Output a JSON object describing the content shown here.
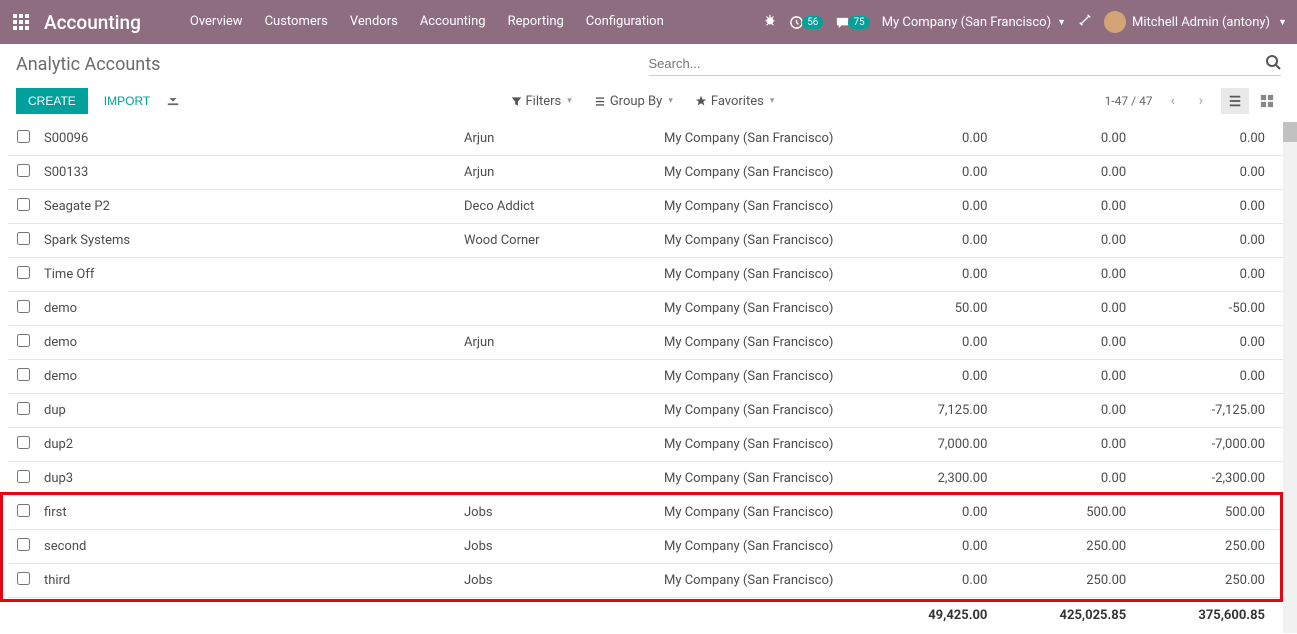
{
  "topnav": {
    "brand": "Accounting",
    "links": [
      "Overview",
      "Customers",
      "Vendors",
      "Accounting",
      "Reporting",
      "Configuration"
    ],
    "badge1": "56",
    "badge2": "75",
    "company": "My Company (San Francisco)",
    "user": "Mitchell Admin (antony)"
  },
  "cp": {
    "title": "Analytic Accounts",
    "search_placeholder": "Search...",
    "create": "CREATE",
    "import": "IMPORT",
    "filters": "Filters",
    "groupby": "Group By",
    "favorites": "Favorites",
    "pager": "1-47 / 47"
  },
  "rows": [
    {
      "name": "S00096",
      "ref": "Arjun",
      "company": "My Company (San Francisco)",
      "a": "0.00",
      "b": "0.00",
      "c": "0.00"
    },
    {
      "name": "S00133",
      "ref": "Arjun",
      "company": "My Company (San Francisco)",
      "a": "0.00",
      "b": "0.00",
      "c": "0.00"
    },
    {
      "name": "Seagate P2",
      "ref": "Deco Addict",
      "company": "My Company (San Francisco)",
      "a": "0.00",
      "b": "0.00",
      "c": "0.00"
    },
    {
      "name": "Spark Systems",
      "ref": "Wood Corner",
      "company": "My Company (San Francisco)",
      "a": "0.00",
      "b": "0.00",
      "c": "0.00"
    },
    {
      "name": "Time Off",
      "ref": "",
      "company": "My Company (San Francisco)",
      "a": "0.00",
      "b": "0.00",
      "c": "0.00"
    },
    {
      "name": "demo",
      "ref": "",
      "company": "My Company (San Francisco)",
      "a": "50.00",
      "b": "0.00",
      "c": "-50.00"
    },
    {
      "name": "demo",
      "ref": "Arjun",
      "company": "My Company (San Francisco)",
      "a": "0.00",
      "b": "0.00",
      "c": "0.00"
    },
    {
      "name": "demo",
      "ref": "",
      "company": "My Company (San Francisco)",
      "a": "0.00",
      "b": "0.00",
      "c": "0.00"
    },
    {
      "name": "dup",
      "ref": "",
      "company": "My Company (San Francisco)",
      "a": "7,125.00",
      "b": "0.00",
      "c": "-7,125.00"
    },
    {
      "name": "dup2",
      "ref": "",
      "company": "My Company (San Francisco)",
      "a": "7,000.00",
      "b": "0.00",
      "c": "-7,000.00"
    },
    {
      "name": "dup3",
      "ref": "",
      "company": "My Company (San Francisco)",
      "a": "2,300.00",
      "b": "0.00",
      "c": "-2,300.00"
    },
    {
      "name": "first",
      "ref": "Jobs",
      "company": "My Company (San Francisco)",
      "a": "0.00",
      "b": "500.00",
      "c": "500.00"
    },
    {
      "name": "second",
      "ref": "Jobs",
      "company": "My Company (San Francisco)",
      "a": "0.00",
      "b": "250.00",
      "c": "250.00"
    },
    {
      "name": "third",
      "ref": "Jobs",
      "company": "My Company (San Francisco)",
      "a": "0.00",
      "b": "250.00",
      "c": "250.00"
    }
  ],
  "totals": {
    "a": "49,425.00",
    "b": "425,025.85",
    "c": "375,600.85"
  }
}
